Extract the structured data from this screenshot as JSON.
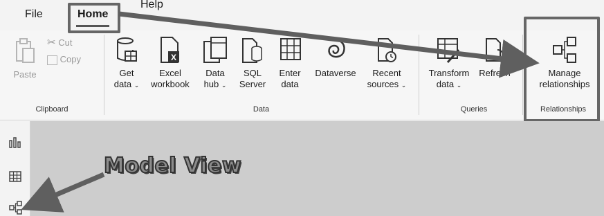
{
  "menu": {
    "file": "File",
    "home": "Home",
    "help": "Help"
  },
  "ribbon": {
    "clipboard": {
      "paste": "Paste",
      "cut": "Cut",
      "copy": "Copy",
      "group_label": "Clipboard"
    },
    "data": {
      "get_data": [
        "Get",
        "data"
      ],
      "excel": [
        "Excel",
        "workbook"
      ],
      "data_hub": [
        "Data",
        "hub"
      ],
      "sql": [
        "SQL",
        "Server"
      ],
      "enter_data": [
        "Enter",
        "data"
      ],
      "dataverse": "Dataverse",
      "recent": [
        "Recent",
        "sources"
      ],
      "group_label": "Data"
    },
    "queries": {
      "transform": [
        "Transform",
        "data"
      ],
      "refresh": "Refresh",
      "group_label": "Queries"
    },
    "relationships": {
      "manage": [
        "Manage",
        "relationships"
      ],
      "group_label": "Relationships"
    }
  },
  "callout": {
    "text": "Model View"
  },
  "colors": {
    "highlight_border": "#666666",
    "arrow": "#5f5f5f",
    "canvas": "#cdcdcd"
  }
}
